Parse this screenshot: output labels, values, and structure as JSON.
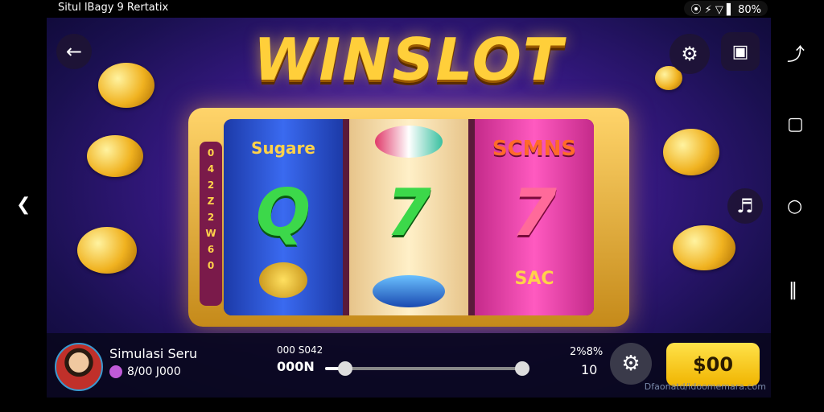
{
  "status_bar": {
    "left_text": "Situl lBagy 9  Rertatix",
    "right_text": "⦿ ⚡ ▽ ▌ 80%"
  },
  "game": {
    "title": "WINSLOT",
    "reel1": {
      "top": "Sugare",
      "mid": "Q",
      "side_col": [
        "0",
        "4",
        "2",
        "Z",
        "2",
        "W",
        "6",
        "0"
      ]
    },
    "reel2": {
      "mid": "7"
    },
    "reel3": {
      "top": "SCMNS",
      "mid": "7",
      "bottom": "SAC"
    }
  },
  "player": {
    "name": "Simulasi Seru",
    "balance": "8/00 J000"
  },
  "controls": {
    "slider_label": "000 S042",
    "slider_value": "000N",
    "slider_level": 0.1,
    "percent_label": "2%8%",
    "lines_value": "10",
    "bet_label": "$00"
  },
  "footer_credit": "Dfaonatd/ldoomemara.com",
  "icons": [
    "back-arrow-icon",
    "settings-gear-icon",
    "fullscreen-icon",
    "android-back-icon",
    "android-home-icon",
    "android-recents-icon",
    "route-icon",
    "sound-icon"
  ]
}
